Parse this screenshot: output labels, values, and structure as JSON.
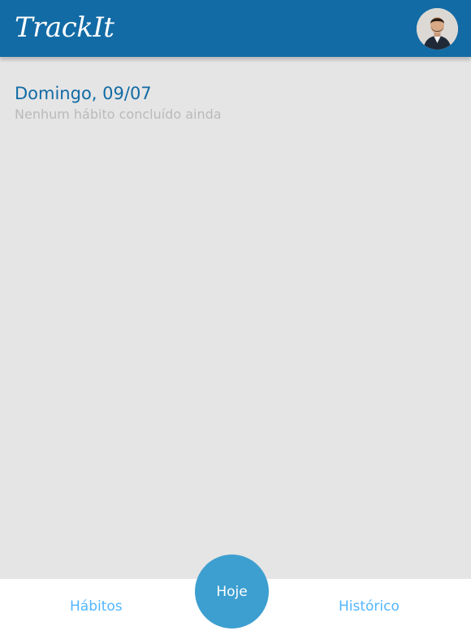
{
  "header": {
    "logo_text": "TrackIt",
    "avatar_icon": "user-avatar"
  },
  "today": {
    "date_title": "Domingo, 09/07",
    "progress_text": "Nenhum hábito concluído ainda"
  },
  "footer": {
    "habits_label": "Hábitos",
    "today_label": "Hoje",
    "history_label": "Histórico"
  },
  "colors": {
    "header_bg": "#126ba5",
    "page_bg": "#e5e5e5",
    "accent_link": "#52b6ff",
    "today_button": "#3d9fd0",
    "subtitle_gray": "#bababa"
  }
}
